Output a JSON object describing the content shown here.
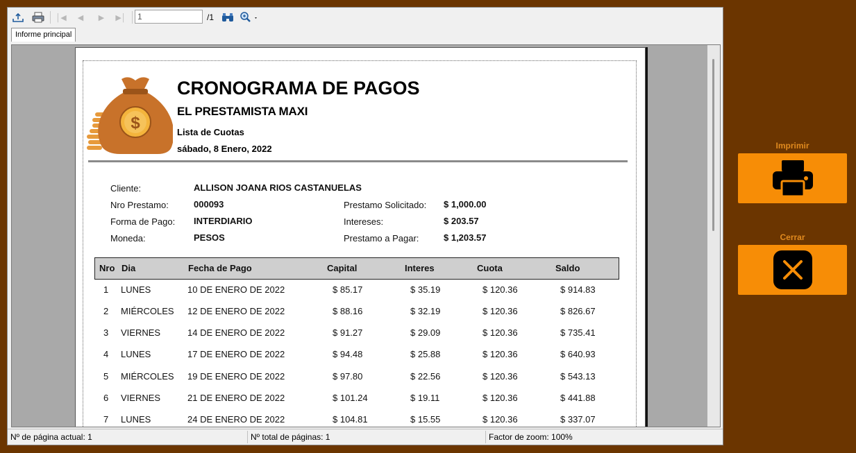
{
  "toolbar": {
    "page_value": "1",
    "page_total": "/1",
    "icons": [
      "export-icon",
      "print-icon",
      "first-page-icon",
      "previous-page-icon",
      "next-page-icon",
      "last-page-icon",
      "find-icon",
      "zoom-icon"
    ]
  },
  "tab": {
    "label": "Informe principal"
  },
  "report": {
    "title": "CRONOGRAMA DE PAGOS",
    "subtitle": "EL PRESTAMISTA MAXI",
    "list_label": "Lista de Cuotas",
    "date": "sábado, 8 Enero, 2022",
    "client_label": "Cliente:",
    "client_value": "ALLISON JOANA RIOS CASTANUELAS",
    "loan_no_label": "Nro Prestamo:",
    "loan_no_value": "000093",
    "payment_form_label": "Forma de Pago:",
    "payment_form_value": "INTERDIARIO",
    "currency_label": "Moneda:",
    "currency_value": "PESOS",
    "requested_label": "Prestamo Solicitado:",
    "requested_value": "$ 1,000.00",
    "interest_label": "Intereses:",
    "interest_value": "$ 203.57",
    "to_pay_label": "Prestamo a Pagar:",
    "to_pay_value": "$ 1,203.57",
    "columns": [
      "Nro",
      "Dia",
      "Fecha de Pago",
      "Capital",
      "Interes",
      "Cuota",
      "Saldo"
    ],
    "rows": [
      [
        "1",
        "LUNES",
        "10 DE ENERO DE 2022",
        "$ 85.17",
        "$ 35.19",
        "$ 120.36",
        "$ 914.83"
      ],
      [
        "2",
        "MIÉRCOLES",
        "12 DE ENERO DE 2022",
        "$ 88.16",
        "$ 32.19",
        "$ 120.36",
        "$ 826.67"
      ],
      [
        "3",
        "VIERNES",
        "14 DE ENERO DE 2022",
        "$ 91.27",
        "$ 29.09",
        "$ 120.36",
        "$ 735.41"
      ],
      [
        "4",
        "LUNES",
        "17 DE ENERO DE 2022",
        "$ 94.48",
        "$ 25.88",
        "$ 120.36",
        "$ 640.93"
      ],
      [
        "5",
        "MIÉRCOLES",
        "19 DE ENERO DE 2022",
        "$ 97.80",
        "$ 22.56",
        "$ 120.36",
        "$ 543.13"
      ],
      [
        "6",
        "VIERNES",
        "21 DE ENERO DE 2022",
        "$ 101.24",
        "$ 19.11",
        "$ 120.36",
        "$ 441.88"
      ],
      [
        "7",
        "LUNES",
        "24 DE ENERO DE 2022",
        "$ 104.81",
        "$ 15.55",
        "$ 120.36",
        "$ 337.07"
      ]
    ]
  },
  "statusbar": {
    "current_page": "Nº de página actual: 1",
    "total_pages": "Nº total de páginas: 1",
    "zoom": "Factor de zoom: 100%"
  },
  "side": {
    "print_label": "Imprimir",
    "close_label": "Cerrar"
  },
  "colors": {
    "background": "#6b3500",
    "accent": "#f78d06",
    "header_row": "#cfcfcf",
    "logo": "#c8722a"
  }
}
